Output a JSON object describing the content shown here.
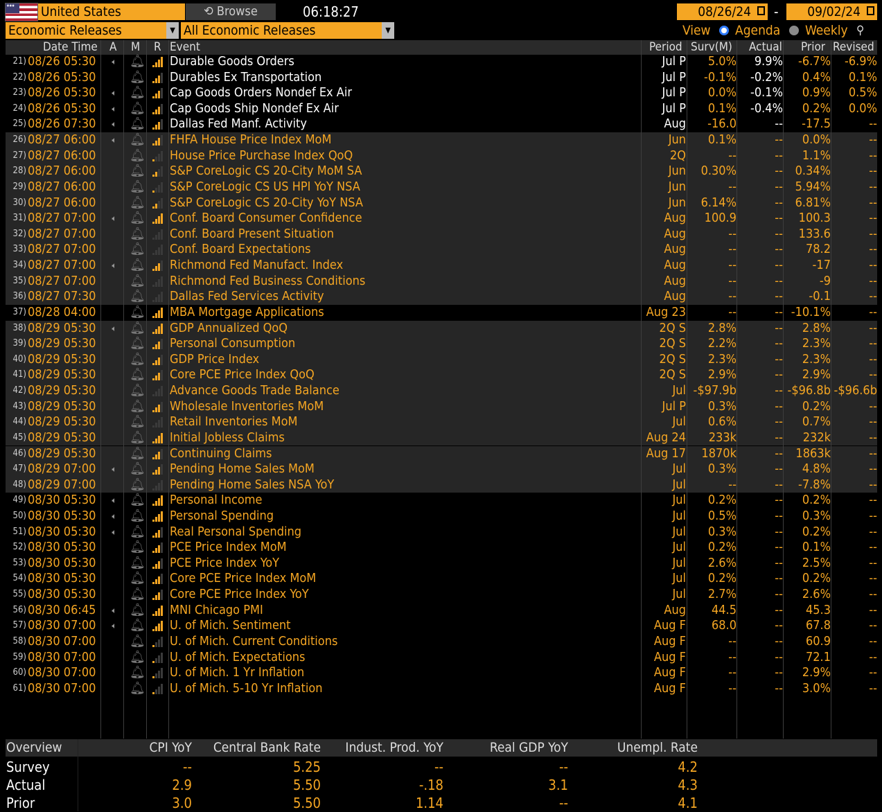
{
  "topbar": {
    "country": "United States",
    "browse": "Browse",
    "time": "06:18:27",
    "date_from": "08/26/24",
    "date_to": "09/02/24",
    "dash": "-",
    "release_type": "Economic Releases",
    "release_filter": "All Economic Releases",
    "view_label": "View",
    "agenda_label": "Agenda",
    "weekly_label": "Weekly"
  },
  "columns": {
    "datetime": "Date Time",
    "a": "A",
    "m": "M",
    "r": "R",
    "event": "Event",
    "period": "Period",
    "survey": "Surv(M)",
    "actual": "Actual",
    "prior": "Prior",
    "revised": "Revised"
  },
  "rows": [
    {
      "n": "21)",
      "dt": "08/26 05:30",
      "a": 1,
      "r": 4,
      "ev": "Durable Goods Orders",
      "white": true,
      "per": "Jul P",
      "sv": "5.0%",
      "ac": "9.9%",
      "pr": "-6.7%",
      "rv": "-6.9%",
      "g": 0
    },
    {
      "n": "22)",
      "dt": "08/26 05:30",
      "a": 0,
      "r": 3,
      "ev": "Durables Ex Transportation",
      "white": true,
      "per": "Jul P",
      "sv": "-0.1%",
      "ac": "-0.2%",
      "pr": "0.4%",
      "rv": "0.1%",
      "g": 0
    },
    {
      "n": "23)",
      "dt": "08/26 05:30",
      "a": 1,
      "r": 3,
      "ev": "Cap Goods Orders Nondef Ex Air",
      "white": true,
      "per": "Jul P",
      "sv": "0.0%",
      "ac": "-0.1%",
      "pr": "0.9%",
      "rv": "0.5%",
      "g": 0
    },
    {
      "n": "24)",
      "dt": "08/26 05:30",
      "a": 1,
      "r": 3,
      "ev": "Cap Goods Ship Nondef Ex Air",
      "white": true,
      "per": "Jul P",
      "sv": "0.1%",
      "ac": "-0.4%",
      "pr": "0.2%",
      "rv": "0.0%",
      "g": 0
    },
    {
      "n": "25)",
      "dt": "08/26 07:30",
      "a": 1,
      "r": 3,
      "ev": "Dallas Fed Manf. Activity",
      "white": true,
      "per": "Aug",
      "sv": "-16.0",
      "ac": "--",
      "pr": "-17.5",
      "rv": "--",
      "g": 0
    },
    {
      "n": "26)",
      "dt": "08/27 06:00",
      "a": 1,
      "r": 3,
      "ev": "FHFA House Price Index MoM",
      "white": false,
      "per": "Jun",
      "sv": "0.1%",
      "ac": "--",
      "pr": "0.0%",
      "rv": "--",
      "g": 1
    },
    {
      "n": "27)",
      "dt": "08/27 06:00",
      "a": 0,
      "r": 1,
      "ev": "House Price Purchase Index QoQ",
      "white": false,
      "per": "2Q",
      "sv": "--",
      "ac": "--",
      "pr": "1.1%",
      "rv": "--",
      "g": 1
    },
    {
      "n": "28)",
      "dt": "08/27 06:00",
      "a": 0,
      "r": 2,
      "ev": "S&P CoreLogic CS 20-City MoM SA",
      "white": false,
      "per": "Jun",
      "sv": "0.30%",
      "ac": "--",
      "pr": "0.34%",
      "rv": "--",
      "g": 1
    },
    {
      "n": "29)",
      "dt": "08/27 06:00",
      "a": 0,
      "r": 1,
      "ev": "S&P CoreLogic CS US HPI YoY NSA",
      "white": false,
      "per": "Jun",
      "sv": "--",
      "ac": "--",
      "pr": "5.94%",
      "rv": "--",
      "g": 1
    },
    {
      "n": "30)",
      "dt": "08/27 06:00",
      "a": 0,
      "r": 2,
      "ev": "S&P CoreLogic CS 20-City YoY NSA",
      "white": false,
      "per": "Jun",
      "sv": "6.14%",
      "ac": "--",
      "pr": "6.81%",
      "rv": "--",
      "g": 1
    },
    {
      "n": "31)",
      "dt": "08/27 07:00",
      "a": 1,
      "r": 4,
      "ev": "Conf. Board Consumer Confidence",
      "white": false,
      "per": "Aug",
      "sv": "100.9",
      "ac": "--",
      "pr": "100.3",
      "rv": "--",
      "g": 1
    },
    {
      "n": "32)",
      "dt": "08/27 07:00",
      "a": 0,
      "r": 0,
      "ev": "Conf. Board Present Situation",
      "white": false,
      "per": "Aug",
      "sv": "--",
      "ac": "--",
      "pr": "133.6",
      "rv": "--",
      "g": 1
    },
    {
      "n": "33)",
      "dt": "08/27 07:00",
      "a": 0,
      "r": 0,
      "ev": "Conf. Board Expectations",
      "white": false,
      "per": "Aug",
      "sv": "--",
      "ac": "--",
      "pr": "78.2",
      "rv": "--",
      "g": 1
    },
    {
      "n": "34)",
      "dt": "08/27 07:00",
      "a": 1,
      "r": 3,
      "ev": "Richmond Fed Manufact. Index",
      "white": false,
      "per": "Aug",
      "sv": "--",
      "ac": "--",
      "pr": "-17",
      "rv": "--",
      "g": 1
    },
    {
      "n": "35)",
      "dt": "08/27 07:00",
      "a": 0,
      "r": 0,
      "ev": "Richmond Fed Business Conditions",
      "white": false,
      "per": "Aug",
      "sv": "--",
      "ac": "--",
      "pr": "-9",
      "rv": "--",
      "g": 1
    },
    {
      "n": "36)",
      "dt": "08/27 07:30",
      "a": 0,
      "r": 0,
      "ev": "Dallas Fed Services Activity",
      "white": false,
      "per": "Aug",
      "sv": "--",
      "ac": "--",
      "pr": "-0.1",
      "rv": "--",
      "g": 1
    },
    {
      "n": "37)",
      "dt": "08/28 04:00",
      "a": 0,
      "r": 4,
      "ev": "MBA Mortgage Applications",
      "white": false,
      "per": "Aug 23",
      "sv": "--",
      "ac": "--",
      "pr": "-10.1%",
      "rv": "--",
      "g": 0
    },
    {
      "n": "38)",
      "dt": "08/29 05:30",
      "a": 1,
      "r": 4,
      "ev": "GDP Annualized QoQ",
      "white": false,
      "per": "2Q S",
      "sv": "2.8%",
      "ac": "--",
      "pr": "2.8%",
      "rv": "--",
      "g": 1
    },
    {
      "n": "39)",
      "dt": "08/29 05:30",
      "a": 0,
      "r": 3,
      "ev": "Personal Consumption",
      "white": false,
      "per": "2Q S",
      "sv": "2.2%",
      "ac": "--",
      "pr": "2.3%",
      "rv": "--",
      "g": 1
    },
    {
      "n": "40)",
      "dt": "08/29 05:30",
      "a": 0,
      "r": 3,
      "ev": "GDP Price Index",
      "white": false,
      "per": "2Q S",
      "sv": "2.3%",
      "ac": "--",
      "pr": "2.3%",
      "rv": "--",
      "g": 1
    },
    {
      "n": "41)",
      "dt": "08/29 05:30",
      "a": 0,
      "r": 3,
      "ev": "Core PCE Price Index QoQ",
      "white": false,
      "per": "2Q S",
      "sv": "2.9%",
      "ac": "--",
      "pr": "2.9%",
      "rv": "--",
      "g": 1
    },
    {
      "n": "42)",
      "dt": "08/29 05:30",
      "a": 0,
      "r": 0,
      "ev": "Advance Goods Trade Balance",
      "white": false,
      "per": "Jul",
      "sv": "-$97.9b",
      "ac": "--",
      "pr": "-$96.8b",
      "rv": "-$96.6b",
      "g": 1
    },
    {
      "n": "43)",
      "dt": "08/29 05:30",
      "a": 0,
      "r": 3,
      "ev": "Wholesale Inventories MoM",
      "white": false,
      "per": "Jul P",
      "sv": "0.3%",
      "ac": "--",
      "pr": "0.2%",
      "rv": "--",
      "g": 1
    },
    {
      "n": "44)",
      "dt": "08/29 05:30",
      "a": 0,
      "r": 0,
      "ev": "Retail Inventories MoM",
      "white": false,
      "per": "Jul",
      "sv": "0.6%",
      "ac": "--",
      "pr": "0.7%",
      "rv": "--",
      "g": 1
    },
    {
      "n": "45)",
      "dt": "08/29 05:30",
      "a": 0,
      "r": 4,
      "ev": "Initial Jobless Claims",
      "white": false,
      "per": "Aug 24",
      "sv": "233k",
      "ac": "--",
      "pr": "232k",
      "rv": "--",
      "g": 1
    },
    {
      "n": "46)",
      "dt": "08/29 05:30",
      "a": 0,
      "r": 3,
      "ev": "Continuing Claims",
      "white": false,
      "per": "Aug 17",
      "sv": "1870k",
      "ac": "--",
      "pr": "1863k",
      "rv": "--",
      "g": 1
    },
    {
      "n": "47)",
      "dt": "08/29 07:00",
      "a": 1,
      "r": 3,
      "ev": "Pending Home Sales MoM",
      "white": false,
      "per": "Jul",
      "sv": "0.3%",
      "ac": "--",
      "pr": "4.8%",
      "rv": "--",
      "g": 1
    },
    {
      "n": "48)",
      "dt": "08/29 07:00",
      "a": 0,
      "r": 0,
      "ev": "Pending Home Sales NSA YoY",
      "white": false,
      "per": "Jul",
      "sv": "--",
      "ac": "--",
      "pr": "-7.8%",
      "rv": "--",
      "g": 1
    },
    {
      "n": "49)",
      "dt": "08/30 05:30",
      "a": 1,
      "r": 4,
      "ev": "Personal Income",
      "white": false,
      "per": "Jul",
      "sv": "0.2%",
      "ac": "--",
      "pr": "0.2%",
      "rv": "--",
      "g": 0
    },
    {
      "n": "50)",
      "dt": "08/30 05:30",
      "a": 1,
      "r": 4,
      "ev": "Personal Spending",
      "white": false,
      "per": "Jul",
      "sv": "0.5%",
      "ac": "--",
      "pr": "0.3%",
      "rv": "--",
      "g": 0
    },
    {
      "n": "51)",
      "dt": "08/30 05:30",
      "a": 1,
      "r": 3,
      "ev": "Real Personal Spending",
      "white": false,
      "per": "Jul",
      "sv": "0.3%",
      "ac": "--",
      "pr": "0.2%",
      "rv": "--",
      "g": 0
    },
    {
      "n": "52)",
      "dt": "08/30 05:30",
      "a": 0,
      "r": 3,
      "ev": "PCE Price Index MoM",
      "white": false,
      "per": "Jul",
      "sv": "0.2%",
      "ac": "--",
      "pr": "0.1%",
      "rv": "--",
      "g": 0
    },
    {
      "n": "53)",
      "dt": "08/30 05:30",
      "a": 0,
      "r": 3,
      "ev": "PCE Price Index YoY",
      "white": false,
      "per": "Jul",
      "sv": "2.6%",
      "ac": "--",
      "pr": "2.5%",
      "rv": "--",
      "g": 0
    },
    {
      "n": "54)",
      "dt": "08/30 05:30",
      "a": 0,
      "r": 3,
      "ev": "Core PCE Price Index MoM",
      "white": false,
      "per": "Jul",
      "sv": "0.2%",
      "ac": "--",
      "pr": "0.2%",
      "rv": "--",
      "g": 0
    },
    {
      "n": "55)",
      "dt": "08/30 05:30",
      "a": 0,
      "r": 3,
      "ev": "Core PCE Price Index YoY",
      "white": false,
      "per": "Jul",
      "sv": "2.7%",
      "ac": "--",
      "pr": "2.6%",
      "rv": "--",
      "g": 0
    },
    {
      "n": "56)",
      "dt": "08/30 06:45",
      "a": 1,
      "r": 4,
      "ev": "MNI Chicago PMI",
      "white": false,
      "per": "Aug",
      "sv": "44.5",
      "ac": "--",
      "pr": "45.3",
      "rv": "--",
      "g": 0
    },
    {
      "n": "57)",
      "dt": "08/30 07:00",
      "a": 1,
      "r": 4,
      "ev": "U. of Mich. Sentiment",
      "white": false,
      "per": "Aug F",
      "sv": "68.0",
      "ac": "--",
      "pr": "67.8",
      "rv": "--",
      "g": 0
    },
    {
      "n": "58)",
      "dt": "08/30 07:00",
      "a": 0,
      "r": 1,
      "ev": "U. of Mich. Current Conditions",
      "white": false,
      "per": "Aug F",
      "sv": "--",
      "ac": "--",
      "pr": "60.9",
      "rv": "--",
      "g": 0
    },
    {
      "n": "59)",
      "dt": "08/30 07:00",
      "a": 0,
      "r": 1,
      "ev": "U. of Mich. Expectations",
      "white": false,
      "per": "Aug F",
      "sv": "--",
      "ac": "--",
      "pr": "72.1",
      "rv": "--",
      "g": 0
    },
    {
      "n": "60)",
      "dt": "08/30 07:00",
      "a": 0,
      "r": 1,
      "ev": "U. of Mich. 1 Yr Inflation",
      "white": false,
      "per": "Aug F",
      "sv": "--",
      "ac": "--",
      "pr": "2.9%",
      "rv": "--",
      "g": 0
    },
    {
      "n": "61)",
      "dt": "08/30 07:00",
      "a": 0,
      "r": 1,
      "ev": "U. of Mich. 5-10 Yr Inflation",
      "white": false,
      "per": "Aug F",
      "sv": "--",
      "ac": "--",
      "pr": "3.0%",
      "rv": "--",
      "g": 0
    }
  ],
  "overview": {
    "title": "Overview",
    "headers": [
      "CPI YoY",
      "Central Bank Rate",
      "Indust. Prod. YoY",
      "Real GDP YoY",
      "Unempl. Rate"
    ],
    "rows": [
      {
        "label": "Survey",
        "values": [
          "--",
          "5.25",
          "--",
          "--",
          "4.2"
        ]
      },
      {
        "label": "Actual",
        "values": [
          "2.9",
          "5.50",
          "-.18",
          "3.1",
          "4.3"
        ]
      },
      {
        "label": "Prior",
        "values": [
          "3.0",
          "5.50",
          "1.14",
          "--",
          "4.1"
        ]
      }
    ]
  },
  "colors": {
    "accent": "#f5a623",
    "background": "#000000",
    "row_shade": "#262626",
    "header_bg": "#2a2a2a",
    "highlight": "#ffffff"
  },
  "icons": {
    "alert": "speaker-icon",
    "monitor": "bell-icon",
    "relevance": "signal-bars-icon",
    "calendar": "calendar-icon",
    "settings": "person-settings-icon"
  }
}
